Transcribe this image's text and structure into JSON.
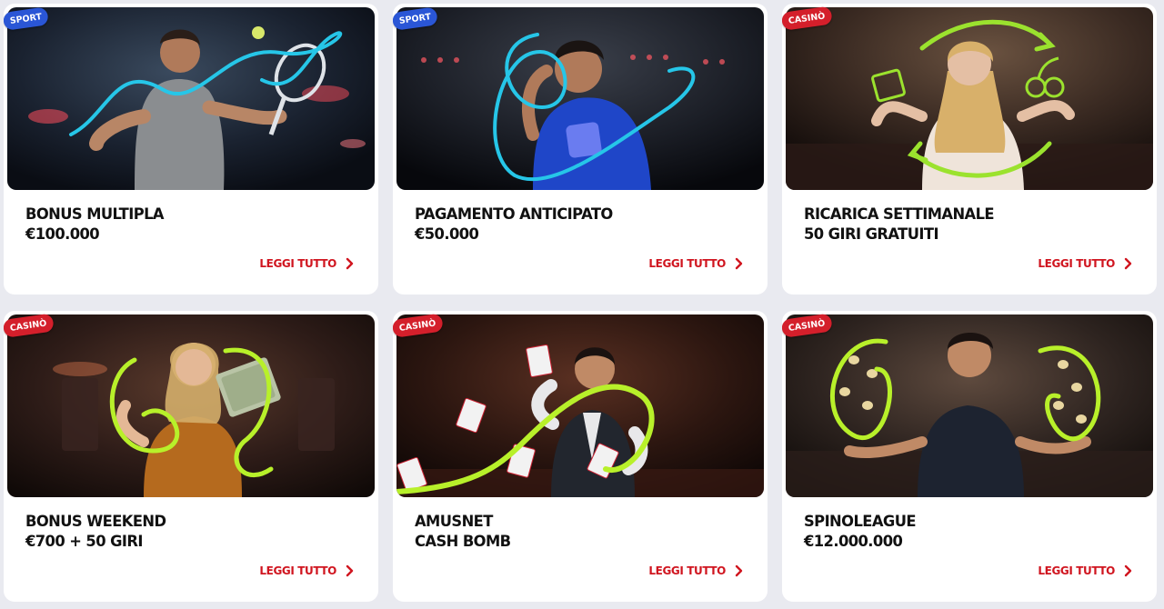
{
  "cards": [
    {
      "badge": "SPORT",
      "badge_color": "#2a56d6",
      "title_line1": "BONUS MULTIPLA",
      "title_line2": "€100.000",
      "link": "LEGGI TUTTO"
    },
    {
      "badge": "SPORT",
      "badge_color": "#2a56d6",
      "title_line1": "PAGAMENTO ANTICIPATO",
      "title_line2": "€50.000",
      "link": "LEGGI TUTTO"
    },
    {
      "badge": "CASINÒ",
      "badge_color": "#d41f2b",
      "title_line1": "RICARICA SETTIMANALE",
      "title_line2": "50 GIRI GRATUITI",
      "link": "LEGGI TUTTO"
    },
    {
      "badge": "CASINÒ",
      "badge_color": "#d41f2b",
      "title_line1": "BONUS WEEKEND",
      "title_line2": "€700 + 50 GIRI",
      "link": "LEGGI TUTTO"
    },
    {
      "badge": "CASINÒ",
      "badge_color": "#d41f2b",
      "title_line1": "AMUSNET",
      "title_line2": "CASH BOMB",
      "link": "LEGGI TUTTO"
    },
    {
      "badge": "CASINÒ",
      "badge_color": "#d41f2b",
      "title_line1": "SPINOLEAGUE",
      "title_line2": "€12.000.000",
      "link": "LEGGI TUTTO"
    }
  ],
  "colors": {
    "page_bg": "#e9eaf0",
    "link": "#d0151f",
    "sport_swirl": "#26c6e8",
    "casino_swirl": "#b8f02a"
  },
  "icons": {
    "link_arrow": "chevron-right-icon"
  }
}
